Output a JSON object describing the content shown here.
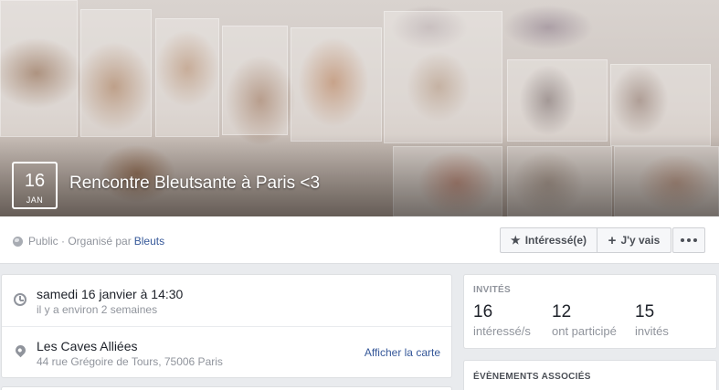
{
  "cover": {
    "date_day": "16",
    "date_month": "JAN",
    "title": "Rencontre Bleutsante à Paris <3"
  },
  "infobar": {
    "privacy": "Public · Organisé par",
    "organizer": "Bleuts",
    "interested_label": "Intéressé(e)",
    "going_label": "J'y vais",
    "icons": {
      "privacy": "globe-icon",
      "interested": "star-icon",
      "going": "plus-icon",
      "more": "more-dots-icon"
    }
  },
  "details": {
    "time_primary": "samedi 16 janvier à 14:30",
    "time_secondary": "il y a environ 2 semaines",
    "location_name": "Les Caves Alliées",
    "location_address": "44 rue Grégoire de Tours, 75006 Paris",
    "map_link": "Afficher la carte",
    "icons": {
      "time": "clock-icon",
      "location": "map-pin-icon"
    }
  },
  "guests": {
    "title": "INVITÉS",
    "stats": [
      {
        "value": "16",
        "label": "intéressé/s"
      },
      {
        "value": "12",
        "label": "ont participé"
      },
      {
        "value": "15",
        "label": "invités"
      }
    ]
  },
  "related": {
    "title": "ÉVÈNEMENTS ASSOCIÉS"
  }
}
